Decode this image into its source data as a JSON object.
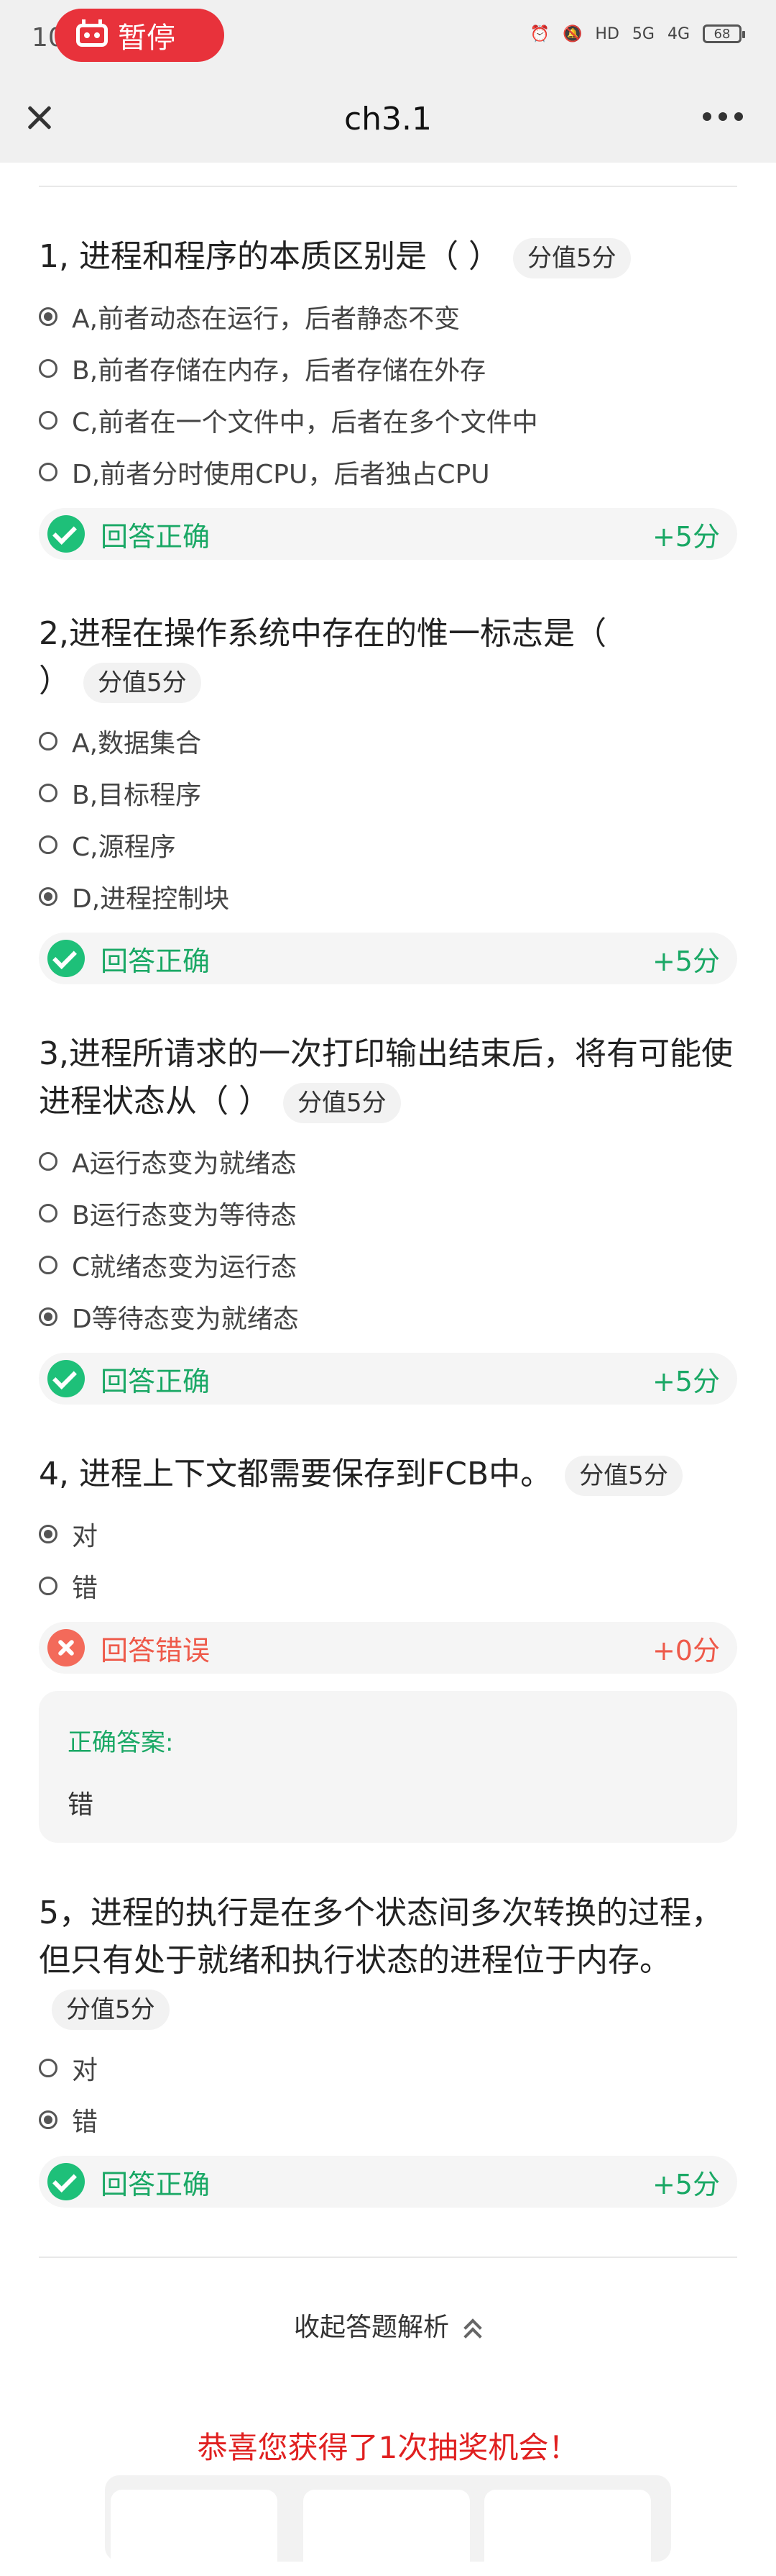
{
  "status_bar": {
    "time_partial": "10",
    "pause_label": "暂停",
    "battery": "68",
    "network_1": "5G",
    "network_2": "4G"
  },
  "nav": {
    "title": "ch3.1"
  },
  "questions": [
    {
      "title": "1, 进程和程序的本质区别是（ ）",
      "score": "分值5分",
      "options": [
        "A,前者动态在运行，后者静态不变",
        "B,前者存储在内存，后者存储在外存",
        "C,前者在一个文件中，后者在多个文件中",
        "D,前者分时使用CPU，后者独占CPU"
      ],
      "selected": 0,
      "result": "回答正确",
      "result_score": "+5分",
      "correct": true
    },
    {
      "title": "2,进程在操作系统中存在的惟一标志是（ ）",
      "score": "分值5分",
      "options": [
        "A,数据集合",
        "B,目标程序",
        "C,源程序",
        "D,进程控制块"
      ],
      "selected": 3,
      "result": "回答正确",
      "result_score": "+5分",
      "correct": true
    },
    {
      "title": "3,进程所请求的一次打印输出结束后，将有可能使进程状态从（ ）",
      "score": "分值5分",
      "options": [
        "A运行态变为就绪态",
        "B运行态变为等待态",
        "C就绪态变为运行态",
        "D等待态变为就绪态"
      ],
      "selected": 3,
      "result": "回答正确",
      "result_score": "+5分",
      "correct": true
    },
    {
      "title": "4, 进程上下文都需要保存到FCB中。",
      "score": "分值5分",
      "options": [
        "对",
        "错"
      ],
      "selected": 0,
      "result": "回答错误",
      "result_score": "+0分",
      "correct": false,
      "answer_label": "正确答案:",
      "answer_value": "错"
    },
    {
      "title": "5，进程的执行是在多个状态间多次转换的过程，但只有处于就绪和执行状态的进程位于内存。",
      "score": "分值5分",
      "options": [
        "对",
        "错"
      ],
      "selected": 1,
      "result": "回答正确",
      "result_score": "+5分",
      "correct": true
    }
  ],
  "collapse_label": "收起答题解析",
  "lottery_text": "恭喜您获得了1次抽奖机会！",
  "colors": {
    "correct": "#1ec079",
    "wrong": "#f36a5a",
    "pause": "#e8323b",
    "lottery": "#e02020"
  }
}
